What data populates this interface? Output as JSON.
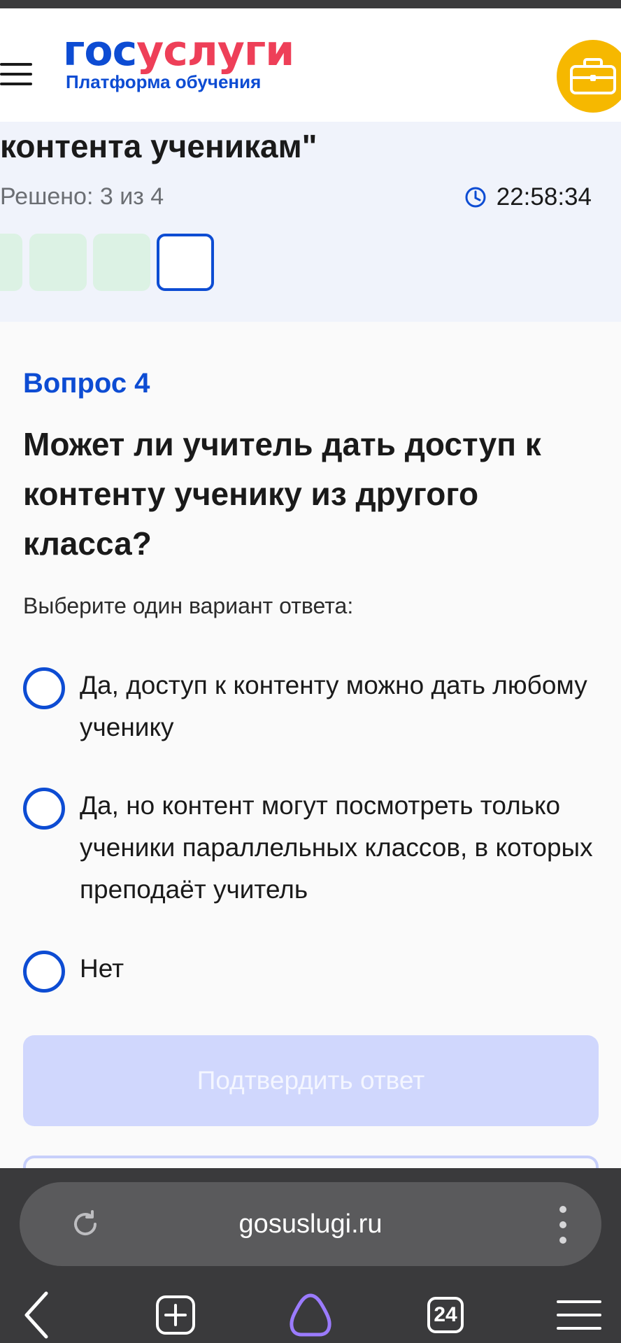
{
  "header": {
    "logo_part1": "гос",
    "logo_part2": "услуги",
    "logo_subtitle": "Платформа обучения",
    "icon_menu": "burger-menu-icon",
    "icon_profile": "briefcase-icon",
    "accent_yellow": "#f6b800"
  },
  "test": {
    "title_fragment": "контента ученикам\"",
    "solved_text": "Решено: 3 из 4",
    "timer": "22:58:34",
    "progress": {
      "solved": 3,
      "total": 4,
      "current": 4
    }
  },
  "question": {
    "label": "Вопрос 4",
    "text": "Может ли учитель дать доступ к контенту ученику из другого класса?",
    "hint": "Выберите один вариант ответа:",
    "options": [
      "Да, доступ к контенту можно дать любому ученику",
      "Да, но контент могут посмотреть только ученики параллельных классов, в которых преподаёт учитель",
      "Нет"
    ],
    "confirm_label": "Подтвердить ответ"
  },
  "browser": {
    "url": "gosuslugi.ru",
    "tab_count": "24"
  },
  "colors": {
    "brand_blue": "#0d4cd3",
    "brand_red": "#ee3f58",
    "solved_green": "#dcf2e4",
    "button_disabled": "#d0d7fd"
  }
}
